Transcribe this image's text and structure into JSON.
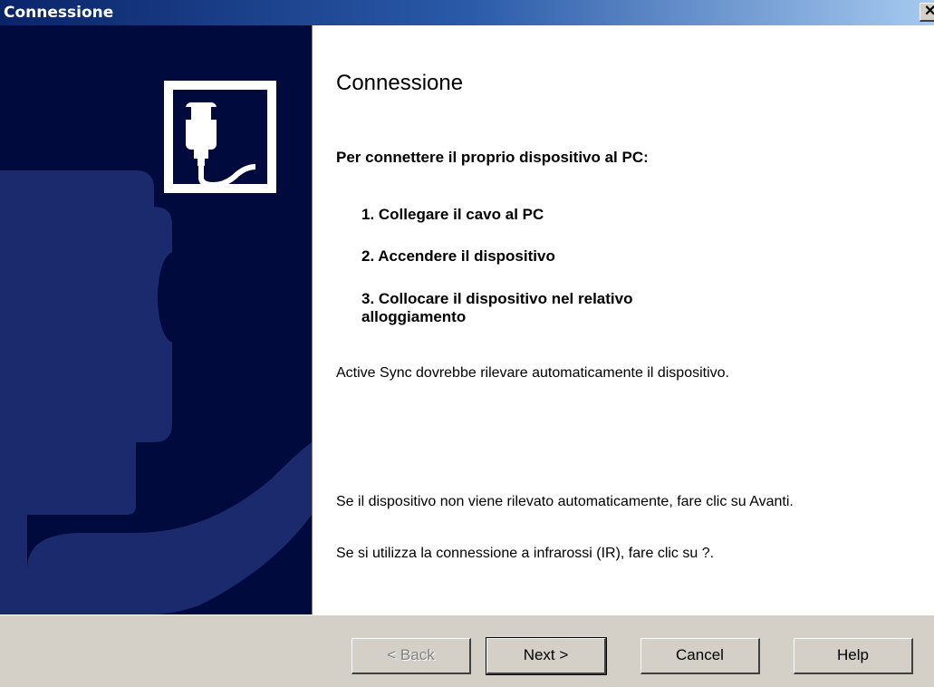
{
  "window": {
    "title": "Connessione",
    "close_glyph": "✕"
  },
  "page": {
    "heading": "Connessione",
    "intro": "Per connettere il proprio dispositivo al PC:",
    "steps": [
      "1. Collegare il cavo al PC",
      "2. Accendere il dispositivo",
      "3. Collocare il dispositivo nel relativo alloggiamento"
    ],
    "auto_detect": "Active Sync dovrebbe rilevare automaticamente il dispositivo.",
    "manual_line1": "Se il dispositivo non viene rilevato automaticamente, fare clic su Avanti.",
    "manual_line2": "Se si utilizza la connessione a infrarossi (IR), fare clic su ?."
  },
  "buttons": {
    "back": "< Back",
    "next": "Next >",
    "cancel": "Cancel",
    "help": "Help"
  },
  "colors": {
    "sidebar_bg": "#000a3c",
    "sidebar_shape": "#1a2a6c",
    "titlebar": "#0a246a",
    "dialog_face": "#d4d0c8"
  },
  "icons": {
    "connector": "cable-plug-icon"
  }
}
